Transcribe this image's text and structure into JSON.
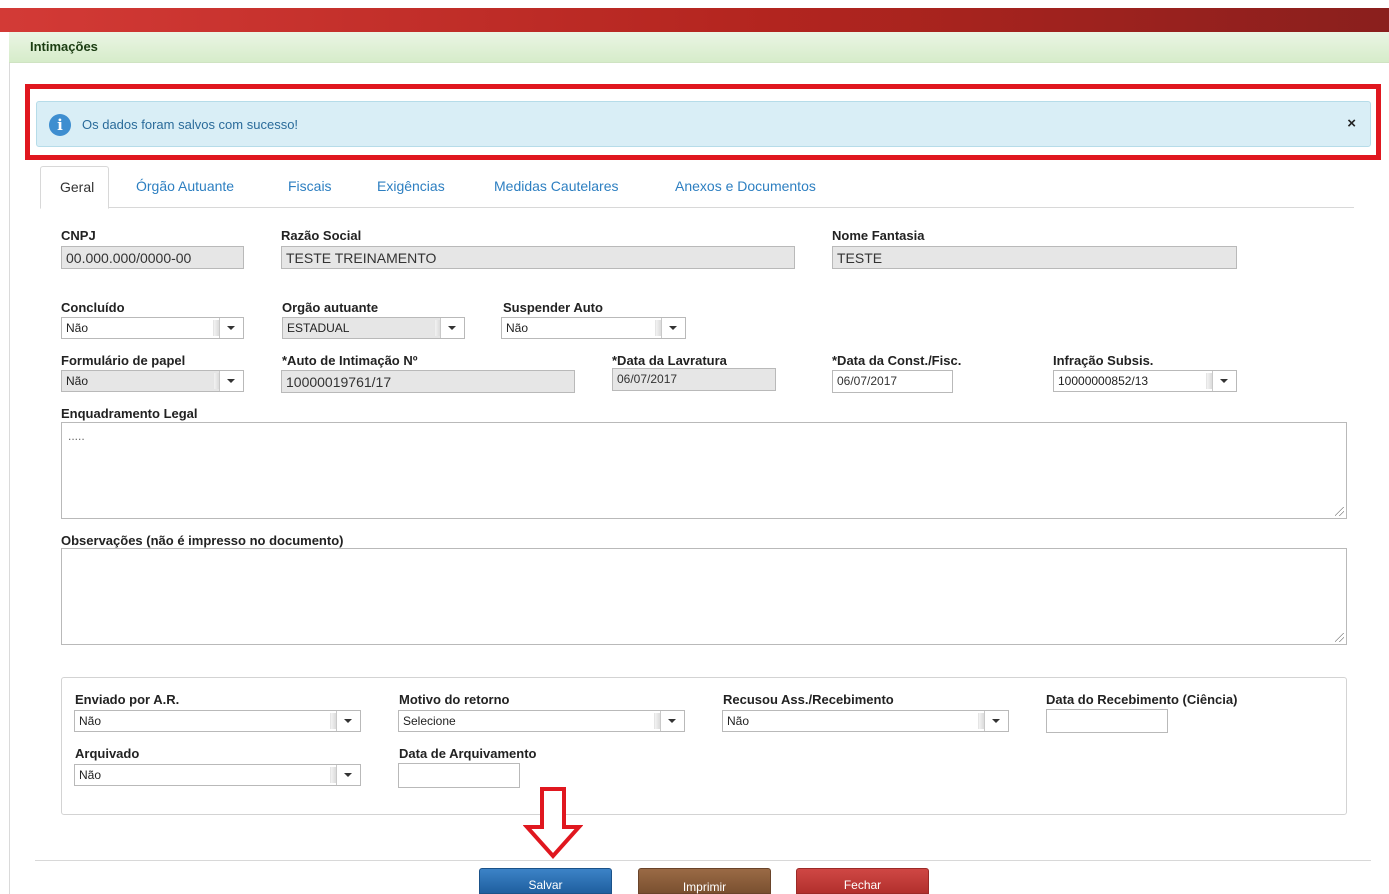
{
  "module": {
    "title": "Intimações"
  },
  "alert": {
    "message": "Os dados foram salvos com sucesso!",
    "close_glyph": "×",
    "info_glyph": "i"
  },
  "tabs": [
    {
      "label": "Geral"
    },
    {
      "label": "Órgão Autuante"
    },
    {
      "label": "Fiscais"
    },
    {
      "label": "Exigências"
    },
    {
      "label": "Medidas Cautelares"
    },
    {
      "label": "Anexos e Documentos"
    }
  ],
  "form": {
    "cnpj": {
      "label": "CNPJ",
      "value": "00.000.000/0000-00"
    },
    "razao_social": {
      "label": "Razão Social",
      "value": "TESTE TREINAMENTO"
    },
    "nome_fantasia": {
      "label": "Nome Fantasia",
      "value": "TESTE"
    },
    "concluido": {
      "label": "Concluído",
      "value": "Não"
    },
    "orgao_autuante": {
      "label": "Orgão autuante",
      "value": "ESTADUAL"
    },
    "suspender_auto": {
      "label": "Suspender Auto",
      "value": "Não"
    },
    "formulario_papel": {
      "label": "Formulário de papel",
      "value": "Não"
    },
    "auto_intimacao": {
      "label": "*Auto de Intimação Nº",
      "value": "10000019761/17"
    },
    "data_lavratura": {
      "label": "*Data da Lavratura",
      "value": "06/07/2017"
    },
    "data_const_fisc": {
      "label": "*Data da Const./Fisc.",
      "value": "06/07/2017"
    },
    "infracao_subsis": {
      "label": "Infração Subsis.",
      "value": "10000000852/13"
    },
    "enquadramento_legal": {
      "label": "Enquadramento Legal",
      "value": "....."
    },
    "observacoes": {
      "label": "Observações (não é impresso no documento)",
      "value": ""
    }
  },
  "panel": {
    "enviado_ar": {
      "label": "Enviado por A.R.",
      "value": "Não"
    },
    "motivo_retorno": {
      "label": "Motivo do retorno",
      "value": "Selecione"
    },
    "recusou": {
      "label": "Recusou Ass./Recebimento",
      "value": "Não"
    },
    "data_recebimento": {
      "label": "Data do Recebimento (Ciência)",
      "value": ""
    },
    "arquivado": {
      "label": "Arquivado",
      "value": "Não"
    },
    "data_arquivamento": {
      "label": "Data de Arquivamento",
      "value": ""
    }
  },
  "actions": {
    "save": "Salvar",
    "print": "Imprimir",
    "close": "Fechar"
  },
  "colors": {
    "header_red": "#b3251f",
    "module_green": "#d6ecca",
    "alert_bg": "#d9eef6",
    "highlight": "#e0171f",
    "save_blue": "#2a6fb3",
    "print_brown": "#8a5c3a",
    "close_red": "#c23b38"
  }
}
